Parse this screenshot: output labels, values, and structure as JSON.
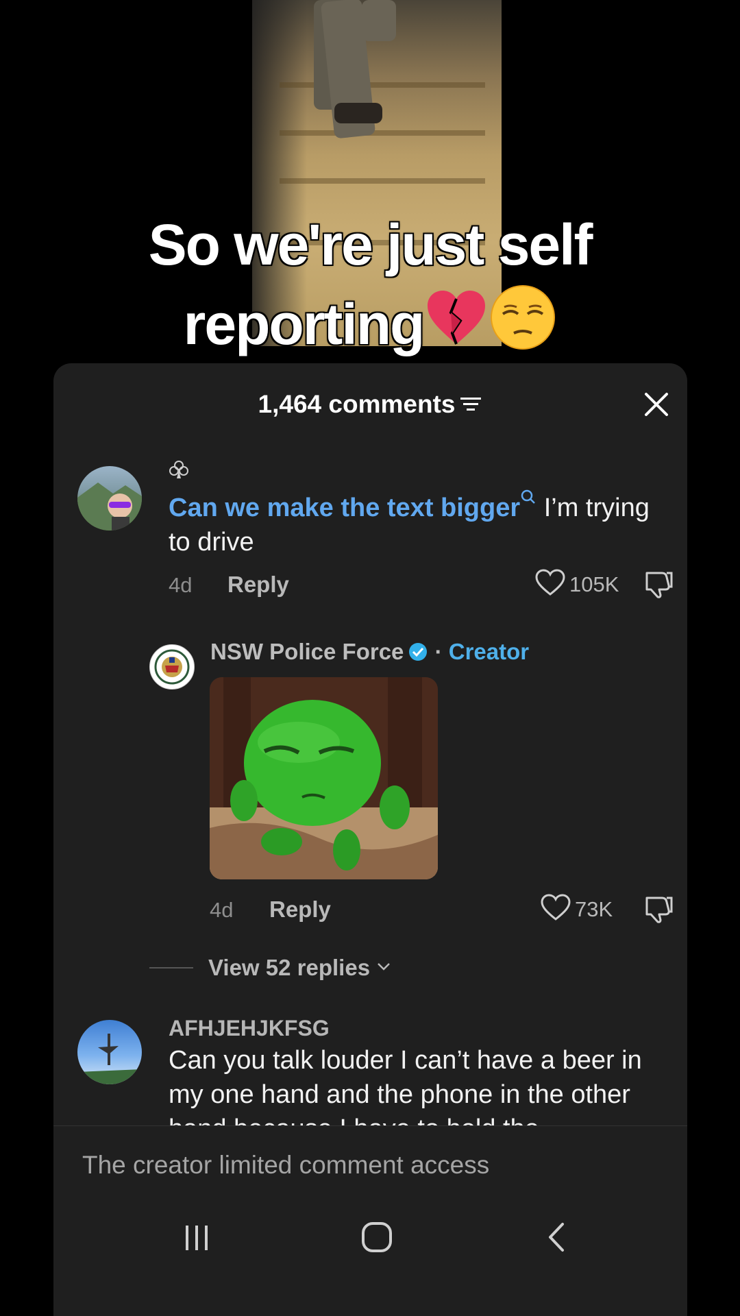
{
  "caption": {
    "line1": "So we're just self",
    "line2": "reporting",
    "emojis": [
      "broken-heart-emoji",
      "relieved-face-emoji"
    ]
  },
  "comments_panel": {
    "title": "1,464 comments",
    "sort_icon": "sort-lines-icon",
    "close_icon": "close-icon"
  },
  "comments": [
    {
      "badge_icon": "club-icon",
      "highlight": "Can we make the text bigger",
      "search_icon": "search-small-icon",
      "text_rest": " I’m trying to drive",
      "time": "4d",
      "reply_label": "Reply",
      "likes": "105K"
    },
    {
      "username": "NSW Police Force",
      "separator": " · ",
      "creator_label": "Creator",
      "sticker": "green-blob-sticker",
      "time": "4d",
      "reply_label": "Reply",
      "likes": "73K"
    },
    {
      "username": "AFHJEHJKFSG",
      "text": "Can you talk louder I can’t have a beer in my one hand and the phone in the other hand because I have to hold the"
    }
  ],
  "view_replies": "View 52 replies",
  "footer": {
    "notice": "The creator limited comment access"
  },
  "navbar": {
    "recents": "recents-icon",
    "home": "home-icon",
    "back": "back-icon"
  },
  "colors": {
    "accent_link": "#61a8ef",
    "creator": "#4fb0ea",
    "sheet_bg": "#1f1f1f"
  }
}
